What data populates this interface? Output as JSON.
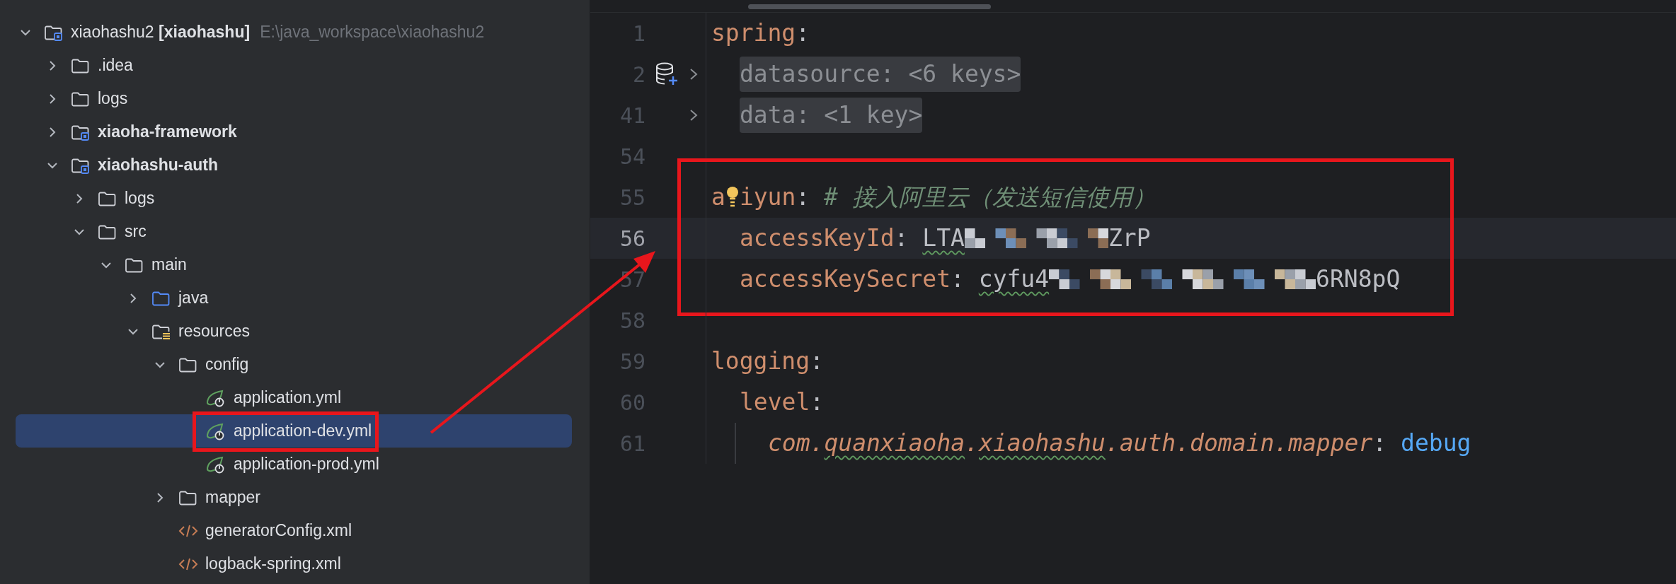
{
  "project_tree": {
    "items": [
      {
        "label": "xiaohashu2 **[xiaohashu]**",
        "path": "E:\\java_workspace\\xiaohashu2",
        "kind": "module",
        "bold": false,
        "boxed": false,
        "expanded": true,
        "selected": false,
        "children": [
          {
            "label": ".idea",
            "kind": "folder",
            "bold": false,
            "boxed": false,
            "expanded": false,
            "selected": false
          },
          {
            "label": "logs",
            "kind": "folder",
            "bold": false,
            "boxed": false,
            "expanded": false,
            "selected": false
          },
          {
            "label": "xiaoha-framework",
            "kind": "module",
            "bold": true,
            "boxed": false,
            "expanded": false,
            "selected": false
          },
          {
            "label": "xiaohashu-auth",
            "kind": "module",
            "bold": true,
            "boxed": false,
            "expanded": true,
            "selected": false,
            "children": [
              {
                "label": "logs",
                "kind": "folder",
                "bold": false,
                "boxed": false,
                "expanded": false,
                "selected": false
              },
              {
                "label": "src",
                "kind": "folder",
                "bold": false,
                "boxed": false,
                "expanded": true,
                "selected": false,
                "children": [
                  {
                    "label": "main",
                    "kind": "folder",
                    "bold": false,
                    "boxed": false,
                    "expanded": true,
                    "selected": false,
                    "children": [
                      {
                        "label": "java",
                        "kind": "sources",
                        "bold": false,
                        "boxed": false,
                        "expanded": false,
                        "selected": false
                      },
                      {
                        "label": "resources",
                        "kind": "resources",
                        "bold": false,
                        "boxed": false,
                        "expanded": true,
                        "selected": false,
                        "children": [
                          {
                            "label": "config",
                            "kind": "folder",
                            "bold": false,
                            "boxed": false,
                            "expanded": true,
                            "selected": false,
                            "children": [
                              {
                                "label": "application.yml",
                                "kind": "spring",
                                "bold": false,
                                "boxed": false,
                                "selected": false
                              },
                              {
                                "label": "application-dev.yml",
                                "kind": "spring",
                                "bold": false,
                                "boxed": true,
                                "selected": true
                              },
                              {
                                "label": "application-prod.yml",
                                "kind": "spring",
                                "bold": false,
                                "boxed": false,
                                "selected": false
                              }
                            ]
                          },
                          {
                            "label": "mapper",
                            "kind": "folder",
                            "bold": false,
                            "boxed": false,
                            "expanded": false,
                            "selected": false
                          },
                          {
                            "label": "generatorConfig.xml",
                            "kind": "xml",
                            "bold": false,
                            "boxed": false,
                            "selected": false
                          },
                          {
                            "label": "logback-spring.xml",
                            "kind": "xml",
                            "bold": false,
                            "boxed": false,
                            "selected": false
                          }
                        ]
                      }
                    ]
                  }
                ]
              }
            ]
          }
        ]
      }
    ]
  },
  "editor": {
    "sections": [
      {
        "boxed": false,
        "lines": [
          {
            "number": "1",
            "current": false,
            "tokens": [
              {
                "kind": "key",
                "text": "spring"
              },
              {
                "kind": "punct",
                "text": ":"
              }
            ]
          },
          {
            "number": "2",
            "current": false,
            "gutter": [
              {
                "kind": "database"
              },
              {
                "kind": "fold"
              }
            ],
            "tokens": [
              {
                "kind": "indent"
              },
              {
                "kind": "folded",
                "text": "datasource: <6 keys>"
              }
            ]
          },
          {
            "number": "41",
            "current": false,
            "gutter": [
              {
                "kind": "fold"
              }
            ],
            "tokens": [
              {
                "kind": "indent"
              },
              {
                "kind": "folded",
                "text": "data: <1 key>"
              }
            ]
          },
          {
            "number": "54",
            "current": false
          }
        ]
      },
      {
        "boxed": true,
        "lines": [
          {
            "number": "55",
            "current": false,
            "tokens": [
              {
                "kind": "key",
                "text": "a"
              },
              {
                "kind": "bulb"
              },
              {
                "kind": "key",
                "text": "iyun"
              },
              {
                "kind": "punct",
                "text": ": "
              },
              {
                "kind": "comment",
                "text": "# 接入阿里云（发送短信使用）"
              }
            ]
          },
          {
            "number": "56",
            "current": true,
            "tokens": [
              {
                "kind": "indent"
              },
              {
                "kind": "key",
                "text": "accessKeyId"
              },
              {
                "kind": "punct",
                "text": ": "
              },
              {
                "kind": "value",
                "text": "LTA",
                "typo": true
              },
              {
                "kind": "shortredaction"
              },
              {
                "kind": "value",
                "text": "ZrP",
                "typo": false
              }
            ]
          },
          {
            "number": "57",
            "current": false,
            "tokens": [
              {
                "kind": "indent"
              },
              {
                "kind": "key",
                "text": "accessKeySecret"
              },
              {
                "kind": "punct",
                "text": ": "
              },
              {
                "kind": "value",
                "text": "cyfu4",
                "typo": true
              },
              {
                "kind": "longredaction"
              },
              {
                "kind": "value",
                "text": "6RN8pQ",
                "typo": false
              }
            ]
          }
        ]
      },
      {
        "boxed": false,
        "lines": [
          {
            "number": "58",
            "current": false
          },
          {
            "number": "59",
            "current": false,
            "tokens": [
              {
                "kind": "key",
                "text": "logging"
              },
              {
                "kind": "punct",
                "text": ":"
              }
            ]
          },
          {
            "number": "60",
            "current": false,
            "tokens": [
              {
                "kind": "indent"
              },
              {
                "kind": "key",
                "text": "level"
              },
              {
                "kind": "punct",
                "text": ":"
              }
            ]
          },
          {
            "number": "61",
            "current": false,
            "tokens": [
              {
                "kind": "guide"
              },
              {
                "kind": "indent"
              },
              {
                "kind": "package",
                "text": "com.",
                "typo": false
              },
              {
                "kind": "package",
                "text": "quanxiaoha",
                "typo": true
              },
              {
                "kind": "package",
                "text": ".",
                "typo": false
              },
              {
                "kind": "package",
                "text": "xiaohashu",
                "typo": true
              },
              {
                "kind": "package",
                "text": ".auth.domain.mapper",
                "typo": false
              },
              {
                "kind": "punct",
                "text": ": "
              },
              {
                "kind": "keyword",
                "text": "debug"
              }
            ]
          }
        ]
      }
    ]
  },
  "annotation_arrow": true
}
